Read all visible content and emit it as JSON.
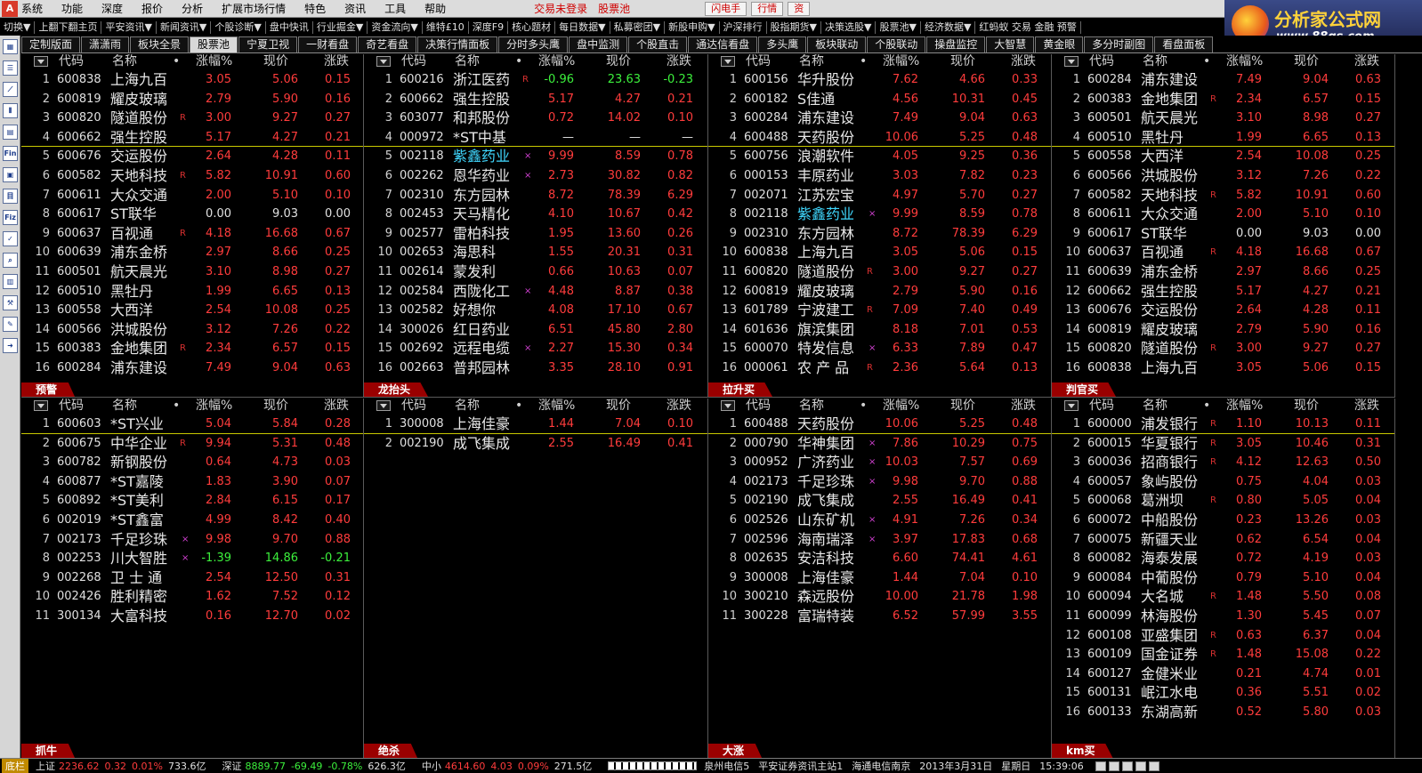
{
  "menubar": {
    "app_icon": "A",
    "items": [
      "系统",
      "功能",
      "深度",
      "报价",
      "分析",
      "扩展市场行情",
      "特色",
      "资讯",
      "工具",
      "帮助"
    ],
    "trade_status": "交易未登录",
    "stock_pool": "股票池",
    "buttons": [
      "闪电手",
      "行情",
      "资"
    ]
  },
  "logo": {
    "name": "分析家公式网",
    "url": "www.88gs.com"
  },
  "toolbar": {
    "items": [
      "切换▼",
      "上翻下翻主页",
      "平安资讯▼",
      "新闻资讯▼",
      "个股诊断▼",
      "盘中快讯",
      "行业掘金▼",
      "资金流向▼",
      "维特£10",
      "深度F9",
      "核心题材",
      "每日数据▼",
      "私募密团▼",
      "新股申购▼",
      "沪深排行",
      "股指期货▼",
      "决策选股▼",
      "股票池▼",
      "经济数据▼",
      "红蚂蚁 交易 金融 预警"
    ]
  },
  "tabs": [
    "定制版面",
    "潇潇雨",
    "板块全景",
    "股票池",
    "宁夏卫视",
    "一财看盘",
    "奇艺看盘",
    "决策行情面板",
    "分时多头鹰",
    "盘中监测",
    "个股直击",
    "通达信看盘",
    "多头鹰",
    "板块联动",
    "个股联动",
    "操盘监控",
    "大智慧",
    "黄金眼",
    "多分时副图",
    "看盘面板"
  ],
  "active_tab": 3,
  "sidebar_icons": [
    "grid-icon",
    "list-icon",
    "trend-chart-icon",
    "kline-chart-icon",
    "news-icon",
    "finance-icon",
    "report-icon",
    "notebook-icon",
    "formula-icon",
    "tick-icon",
    "search-icon",
    "layout-icon",
    "tools-icon",
    "pen-icon",
    "exit-icon"
  ],
  "columns": {
    "code": "代码",
    "name": "名称",
    "pct": "涨幅%",
    "price": "现价",
    "chg": "涨跌"
  },
  "panels": [
    {
      "label": "",
      "rows": [
        [
          "1",
          "600838",
          "上海九百",
          "",
          "3.05",
          "5.06",
          "0.15"
        ],
        [
          "2",
          "600819",
          "耀皮玻璃",
          "",
          "2.79",
          "5.90",
          "0.16"
        ],
        [
          "3",
          "600820",
          "隧道股份",
          "R",
          "3.00",
          "9.27",
          "0.27"
        ],
        [
          "4",
          "600662",
          "强生控股",
          "",
          "5.17",
          "4.27",
          "0.21"
        ],
        [
          "5",
          "600676",
          "交运股份",
          "",
          "2.64",
          "4.28",
          "0.11"
        ],
        [
          "6",
          "600582",
          "天地科技",
          "R",
          "5.82",
          "10.91",
          "0.60"
        ],
        [
          "7",
          "600611",
          "大众交通",
          "",
          "2.00",
          "5.10",
          "0.10"
        ],
        [
          "8",
          "600617",
          "ST联华",
          "",
          "0.00",
          "9.03",
          "0.00"
        ],
        [
          "9",
          "600637",
          "百视通",
          "R",
          "4.18",
          "16.68",
          "0.67"
        ],
        [
          "10",
          "600639",
          "浦东金桥",
          "",
          "2.97",
          "8.66",
          "0.25"
        ],
        [
          "11",
          "600501",
          "航天晨光",
          "",
          "3.10",
          "8.98",
          "0.27"
        ],
        [
          "12",
          "600510",
          "黑牡丹",
          "",
          "1.99",
          "6.65",
          "0.13"
        ],
        [
          "13",
          "600558",
          "大西洋",
          "",
          "2.54",
          "10.08",
          "0.25"
        ],
        [
          "14",
          "600566",
          "洪城股份",
          "",
          "3.12",
          "7.26",
          "0.22"
        ],
        [
          "15",
          "600383",
          "金地集团",
          "R",
          "2.34",
          "6.57",
          "0.15"
        ],
        [
          "16",
          "600284",
          "浦东建设",
          "",
          "7.49",
          "9.04",
          "0.63"
        ]
      ]
    },
    {
      "label": "",
      "rows": [
        [
          "1",
          "600216",
          "浙江医药",
          "R",
          "-0.96",
          "23.63",
          "-0.23"
        ],
        [
          "2",
          "600662",
          "强生控股",
          "",
          "5.17",
          "4.27",
          "0.21"
        ],
        [
          "3",
          "603077",
          "和邦股份",
          "",
          "0.72",
          "14.02",
          "0.10"
        ],
        [
          "4",
          "000972",
          "*ST中基",
          "",
          "—",
          "—",
          "—"
        ],
        [
          "5",
          "002118",
          "紫鑫药业",
          "×",
          "9.99",
          "8.59",
          "0.78"
        ],
        [
          "6",
          "002262",
          "恩华药业",
          "×",
          "2.73",
          "30.82",
          "0.82"
        ],
        [
          "7",
          "002310",
          "东方园林",
          "",
          "8.72",
          "78.39",
          "6.29"
        ],
        [
          "8",
          "002453",
          "天马精化",
          "",
          "4.10",
          "10.67",
          "0.42"
        ],
        [
          "9",
          "002577",
          "雷柏科技",
          "",
          "1.95",
          "13.60",
          "0.26"
        ],
        [
          "10",
          "002653",
          "海思科",
          "",
          "1.55",
          "20.31",
          "0.31"
        ],
        [
          "11",
          "002614",
          "蒙发利",
          "",
          "0.66",
          "10.63",
          "0.07"
        ],
        [
          "12",
          "002584",
          "西陇化工",
          "×",
          "4.48",
          "8.87",
          "0.38"
        ],
        [
          "13",
          "002582",
          "好想你",
          "",
          "4.08",
          "17.10",
          "0.67"
        ],
        [
          "14",
          "300026",
          "红日药业",
          "",
          "6.51",
          "45.80",
          "2.80"
        ],
        [
          "15",
          "002692",
          "远程电缆",
          "×",
          "2.27",
          "15.30",
          "0.34"
        ],
        [
          "16",
          "002663",
          "普邦园林",
          "",
          "3.35",
          "28.10",
          "0.91"
        ]
      ]
    },
    {
      "label": "",
      "rows": [
        [
          "1",
          "600156",
          "华升股份",
          "",
          "7.62",
          "4.66",
          "0.33"
        ],
        [
          "2",
          "600182",
          "S佳通",
          "",
          "4.56",
          "10.31",
          "0.45"
        ],
        [
          "3",
          "600284",
          "浦东建设",
          "",
          "7.49",
          "9.04",
          "0.63"
        ],
        [
          "4",
          "600488",
          "天药股份",
          "",
          "10.06",
          "5.25",
          "0.48"
        ],
        [
          "5",
          "600756",
          "浪潮软件",
          "",
          "4.05",
          "9.25",
          "0.36"
        ],
        [
          "6",
          "000153",
          "丰原药业",
          "",
          "3.03",
          "7.82",
          "0.23"
        ],
        [
          "7",
          "002071",
          "江苏宏宝",
          "",
          "4.97",
          "5.70",
          "0.27"
        ],
        [
          "8",
          "002118",
          "紫鑫药业",
          "×",
          "9.99",
          "8.59",
          "0.78"
        ],
        [
          "9",
          "002310",
          "东方园林",
          "",
          "8.72",
          "78.39",
          "6.29"
        ],
        [
          "10",
          "600838",
          "上海九百",
          "",
          "3.05",
          "5.06",
          "0.15"
        ],
        [
          "11",
          "600820",
          "隧道股份",
          "R",
          "3.00",
          "9.27",
          "0.27"
        ],
        [
          "12",
          "600819",
          "耀皮玻璃",
          "",
          "2.79",
          "5.90",
          "0.16"
        ],
        [
          "13",
          "601789",
          "宁波建工",
          "R",
          "7.09",
          "7.40",
          "0.49"
        ],
        [
          "14",
          "601636",
          "旗滨集团",
          "",
          "8.18",
          "7.01",
          "0.53"
        ],
        [
          "15",
          "600070",
          "特发信息",
          "×",
          "6.33",
          "7.89",
          "0.47"
        ],
        [
          "16",
          "000061",
          "农 产 品",
          "R",
          "2.36",
          "5.64",
          "0.13"
        ]
      ]
    },
    {
      "label": "",
      "rows": [
        [
          "1",
          "600284",
          "浦东建设",
          "",
          "7.49",
          "9.04",
          "0.63"
        ],
        [
          "2",
          "600383",
          "金地集团",
          "R",
          "2.34",
          "6.57",
          "0.15"
        ],
        [
          "3",
          "600501",
          "航天晨光",
          "",
          "3.10",
          "8.98",
          "0.27"
        ],
        [
          "4",
          "600510",
          "黑牡丹",
          "",
          "1.99",
          "6.65",
          "0.13"
        ],
        [
          "5",
          "600558",
          "大西洋",
          "",
          "2.54",
          "10.08",
          "0.25"
        ],
        [
          "6",
          "600566",
          "洪城股份",
          "",
          "3.12",
          "7.26",
          "0.22"
        ],
        [
          "7",
          "600582",
          "天地科技",
          "R",
          "5.82",
          "10.91",
          "0.60"
        ],
        [
          "8",
          "600611",
          "大众交通",
          "",
          "2.00",
          "5.10",
          "0.10"
        ],
        [
          "9",
          "600617",
          "ST联华",
          "",
          "0.00",
          "9.03",
          "0.00"
        ],
        [
          "10",
          "600637",
          "百视通",
          "R",
          "4.18",
          "16.68",
          "0.67"
        ],
        [
          "11",
          "600639",
          "浦东金桥",
          "",
          "2.97",
          "8.66",
          "0.25"
        ],
        [
          "12",
          "600662",
          "强生控股",
          "",
          "5.17",
          "4.27",
          "0.21"
        ],
        [
          "13",
          "600676",
          "交运股份",
          "",
          "2.64",
          "4.28",
          "0.11"
        ],
        [
          "14",
          "600819",
          "耀皮玻璃",
          "",
          "2.79",
          "5.90",
          "0.16"
        ],
        [
          "15",
          "600820",
          "隧道股份",
          "R",
          "3.00",
          "9.27",
          "0.27"
        ],
        [
          "16",
          "600838",
          "上海九百",
          "",
          "3.05",
          "5.06",
          "0.15"
        ]
      ]
    },
    {
      "label": "预警",
      "rows": [
        [
          "1",
          "600603",
          "*ST兴业",
          "",
          "5.04",
          "5.84",
          "0.28"
        ],
        [
          "2",
          "600675",
          "中华企业",
          "R",
          "9.94",
          "5.31",
          "0.48"
        ],
        [
          "3",
          "600782",
          "新钢股份",
          "",
          "0.64",
          "4.73",
          "0.03"
        ],
        [
          "4",
          "600877",
          "*ST嘉陵",
          "",
          "1.83",
          "3.90",
          "0.07"
        ],
        [
          "5",
          "600892",
          "*ST美利",
          "",
          "2.84",
          "6.15",
          "0.17"
        ],
        [
          "6",
          "002019",
          "*ST鑫富",
          "",
          "4.99",
          "8.42",
          "0.40"
        ],
        [
          "7",
          "002173",
          "千足珍珠",
          "×",
          "9.98",
          "9.70",
          "0.88"
        ],
        [
          "8",
          "002253",
          "川大智胜",
          "×",
          "-1.39",
          "14.86",
          "-0.21"
        ],
        [
          "9",
          "002268",
          "卫 士 通",
          "",
          "2.54",
          "12.50",
          "0.31"
        ],
        [
          "10",
          "002426",
          "胜利精密",
          "",
          "1.62",
          "7.52",
          "0.12"
        ],
        [
          "11",
          "300134",
          "大富科技",
          "",
          "0.16",
          "12.70",
          "0.02"
        ]
      ]
    },
    {
      "label": "龙抬头",
      "rows": [
        [
          "1",
          "300008",
          "上海佳豪",
          "",
          "1.44",
          "7.04",
          "0.10"
        ],
        [
          "2",
          "002190",
          "成飞集成",
          "",
          "2.55",
          "16.49",
          "0.41"
        ]
      ]
    },
    {
      "label": "拉升买",
      "rows": [
        [
          "1",
          "600488",
          "天药股份",
          "",
          "10.06",
          "5.25",
          "0.48"
        ],
        [
          "2",
          "000790",
          "华神集团",
          "×",
          "7.86",
          "10.29",
          "0.75"
        ],
        [
          "3",
          "000952",
          "广济药业",
          "×",
          "10.03",
          "7.57",
          "0.69"
        ],
        [
          "4",
          "002173",
          "千足珍珠",
          "×",
          "9.98",
          "9.70",
          "0.88"
        ],
        [
          "5",
          "002190",
          "成飞集成",
          "",
          "2.55",
          "16.49",
          "0.41"
        ],
        [
          "6",
          "002526",
          "山东矿机",
          "×",
          "4.91",
          "7.26",
          "0.34"
        ],
        [
          "7",
          "002596",
          "海南瑞泽",
          "×",
          "3.97",
          "17.83",
          "0.68"
        ],
        [
          "8",
          "002635",
          "安洁科技",
          "",
          "6.60",
          "74.41",
          "4.61"
        ],
        [
          "9",
          "300008",
          "上海佳豪",
          "",
          "1.44",
          "7.04",
          "0.10"
        ],
        [
          "10",
          "300210",
          "森远股份",
          "",
          "10.00",
          "21.78",
          "1.98"
        ],
        [
          "11",
          "300228",
          "富瑞特装",
          "",
          "6.52",
          "57.99",
          "3.55"
        ]
      ]
    },
    {
      "label": "判官买",
      "rows": [
        [
          "1",
          "600000",
          "浦发银行",
          "R",
          "1.10",
          "10.13",
          "0.11"
        ],
        [
          "2",
          "600015",
          "华夏银行",
          "R",
          "3.05",
          "10.46",
          "0.31"
        ],
        [
          "3",
          "600036",
          "招商银行",
          "R",
          "4.12",
          "12.63",
          "0.50"
        ],
        [
          "4",
          "600057",
          "象屿股份",
          "",
          "0.75",
          "4.04",
          "0.03"
        ],
        [
          "5",
          "600068",
          "葛洲坝",
          "R",
          "0.80",
          "5.05",
          "0.04"
        ],
        [
          "6",
          "600072",
          "中船股份",
          "",
          "0.23",
          "13.26",
          "0.03"
        ],
        [
          "7",
          "600075",
          "新疆天业",
          "",
          "0.62",
          "6.54",
          "0.04"
        ],
        [
          "8",
          "600082",
          "海泰发展",
          "",
          "0.72",
          "4.19",
          "0.03"
        ],
        [
          "9",
          "600084",
          "中葡股份",
          "",
          "0.79",
          "5.10",
          "0.04"
        ],
        [
          "10",
          "600094",
          "大名城",
          "R",
          "1.48",
          "5.50",
          "0.08"
        ],
        [
          "11",
          "600099",
          "林海股份",
          "",
          "1.30",
          "5.45",
          "0.07"
        ],
        [
          "12",
          "600108",
          "亚盛集团",
          "R",
          "0.63",
          "6.37",
          "0.04"
        ],
        [
          "13",
          "600109",
          "国金证券",
          "R",
          "1.48",
          "15.08",
          "0.22"
        ],
        [
          "14",
          "600127",
          "金健米业",
          "",
          "0.21",
          "4.74",
          "0.01"
        ],
        [
          "15",
          "600131",
          "岷江水电",
          "",
          "0.36",
          "5.51",
          "0.02"
        ],
        [
          "16",
          "600133",
          "东湖高新",
          "",
          "0.52",
          "5.80",
          "0.03"
        ]
      ]
    }
  ],
  "bottom_labels": [
    "抓牛",
    "绝杀",
    "大涨",
    "km买"
  ],
  "statusbar": {
    "badge": "底栏",
    "items": [
      {
        "label": "上证",
        "index": "2236.62",
        "change": "0.32",
        "pct": "0.01%",
        "volume": "733.6亿"
      },
      {
        "label": "深证",
        "index": "8889.77",
        "change": "-69.49",
        "pct": "-0.78%",
        "volume": "626.3亿"
      },
      {
        "label": "中小",
        "index": "4614.60",
        "change": "4.03",
        "pct": "0.09%",
        "volume": "271.5亿"
      }
    ],
    "info": [
      "泉州电信5",
      "平安证券资讯主站1",
      "海通电信南京",
      "2013年3月31日",
      "星期日",
      "15:39:06"
    ]
  },
  "colors": {
    "up": "#ff3c3c",
    "down": "#3cf03c",
    "label_bg": "#9a0000",
    "highlight": "#40d8ff"
  },
  "cyan_names": [
    "紫鑫药业"
  ]
}
